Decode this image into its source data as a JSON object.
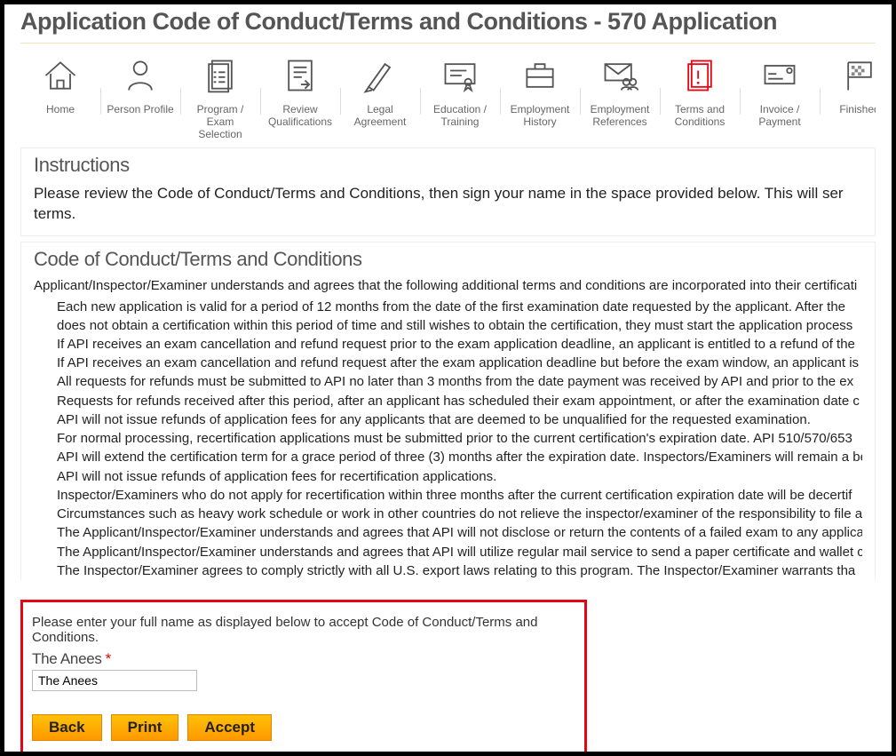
{
  "page_title": "Application Code of Conduct/Terms and Conditions - 570 Application",
  "nav": [
    {
      "label": "Home",
      "icon": "home-icon"
    },
    {
      "label": "Person Profile",
      "icon": "person-icon"
    },
    {
      "label": "Program / Exam Selection",
      "icon": "checklist-icon"
    },
    {
      "label": "Review Qualifications",
      "icon": "document-arrow-icon"
    },
    {
      "label": "Legal Agreement",
      "icon": "pen-icon"
    },
    {
      "label": "Education / Training",
      "icon": "certificate-icon"
    },
    {
      "label": "Employment History",
      "icon": "briefcase-icon"
    },
    {
      "label": "Employment References",
      "icon": "envelope-people-icon"
    },
    {
      "label": "Terms and Conditions",
      "icon": "alert-doc-icon",
      "active": true
    },
    {
      "label": "Invoice / Payment",
      "icon": "invoice-icon"
    },
    {
      "label": "Finished",
      "icon": "flag-icon"
    }
  ],
  "instructions": {
    "title": "Instructions",
    "body": "Please review the Code of Conduct/Terms and Conditions, then sign your name in the space provided below. This will ser terms."
  },
  "terms": {
    "title": "Code of Conduct/Terms and Conditions",
    "intro": "Applicant/Inspector/Examiner understands and agrees that the following additional terms and conditions are incorporated into their certificati",
    "items": [
      "Each new application is valid for a period of 12 months from the date of the first examination date requested by the applicant.  After the does not obtain a certification within this period of time and still wishes to obtain the certification, they must start the application process",
      "If API receives an exam cancellation and refund request prior to the exam application deadline, an applicant is entitled to a refund of the",
      "If API receives an exam cancellation and refund request after the exam application deadline but before the exam window, an applicant is",
      "All requests for refunds must be submitted to API no later than 3 months from the date payment was received by API and prior to the ex",
      "Requests for refunds received after this period, after an applicant has scheduled their exam appointment, or after the examination date c",
      "API will not issue refunds of application fees for any applicants that are deemed to be unqualified for the requested examination.",
      "For normal processing, recertification applications must be submitted prior to the current certification's expiration date. API 510/570/653",
      "API will extend the certification term for a grace period of three (3) months after the expiration date. Inspectors/Examiners will remain a be required.",
      "API will not issue refunds of application fees for recertification applications.",
      "Inspector/Examiners who do not apply for recertification within three months after the current certification expiration date will be decertif",
      "Circumstances such as heavy work schedule or work in other countries do not relieve the inspector/examiner of the responsibility to file a",
      "The Applicant/Inspector/Examiner understands and agrees that API will not disclose or return the contents of a failed exam to any applica",
      "The Applicant/Inspector/Examiner understands and agrees that API will utilize regular mail service to send a paper certificate and wallet c applicant's address.",
      "The Inspector/Examiner agrees to comply strictly with all U.S. export laws relating to this program.  The Inspector/Examiner warrants tha"
    ]
  },
  "signature": {
    "prompt": "Please enter your full name as displayed below to accept Code of Conduct/Terms and Conditions.",
    "label": "The Anees",
    "value": "The Anees"
  },
  "buttons": {
    "back": "Back",
    "print": "Print",
    "accept": "Accept"
  }
}
